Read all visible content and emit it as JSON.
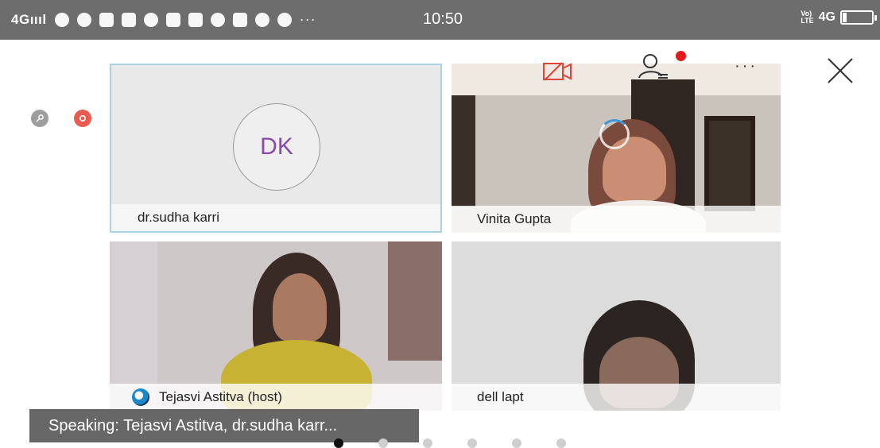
{
  "status_bar": {
    "network": "4G",
    "time": "10:50",
    "lte_label": "Vo) LTE",
    "data_label": "4G",
    "more": "···",
    "battery_level": 0.15
  },
  "participants": [
    {
      "name": "dr.sudha karri",
      "initials": "DK"
    },
    {
      "name": "Vinita Gupta"
    },
    {
      "name": "Tejasvi Astitva (host)"
    },
    {
      "name": "dell lapt"
    }
  ],
  "toolbar": {
    "more_label": "···"
  },
  "speaking": "Speaking: Tejasvi Astitva, dr.sudha karr...",
  "pager": {
    "pages": 6,
    "active": 0
  },
  "colors": {
    "accent_red": "#e41b1b",
    "avatar_text": "#8a4aa8",
    "active_border": "#a9d2e2"
  }
}
